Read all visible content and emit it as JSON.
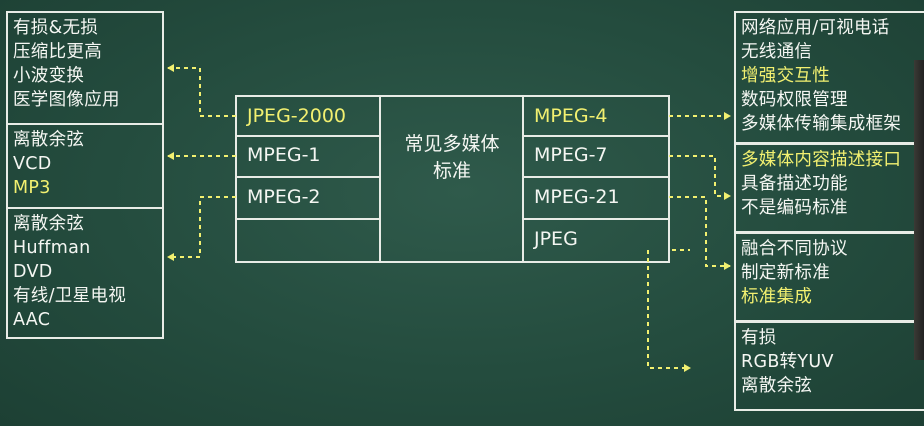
{
  "center": {
    "title_line1": "常见多媒体",
    "title_line2": "标准",
    "left_col": [
      "JPEG-2000",
      "MPEG-1",
      "MPEG-2",
      ""
    ],
    "right_col": [
      "MPEG-4",
      "MPEG-7",
      "MPEG-21",
      "JPEG"
    ]
  },
  "left_boxes": [
    {
      "lines": [
        {
          "text": "有损&无损",
          "hl": false
        },
        {
          "text": "压缩比更高",
          "hl": false
        },
        {
          "text": "小波变换",
          "hl": false
        },
        {
          "text": "医学图像应用",
          "hl": false
        }
      ]
    },
    {
      "lines": [
        {
          "text": "离散余弦",
          "hl": false
        },
        {
          "text": "VCD",
          "hl": false
        },
        {
          "text": "MP3",
          "hl": true
        }
      ]
    },
    {
      "lines": [
        {
          "text": "离散余弦",
          "hl": false
        },
        {
          "text": "Huffman",
          "hl": false
        },
        {
          "text": "DVD",
          "hl": false
        },
        {
          "text": "有线/卫星电视",
          "hl": false
        },
        {
          "text": "AAC",
          "hl": false
        }
      ]
    }
  ],
  "right_boxes": [
    {
      "lines": [
        {
          "text": "网络应用/可视电话",
          "hl": false
        },
        {
          "text": "无线通信",
          "hl": false
        },
        {
          "text": "增强交互性",
          "hl": true
        },
        {
          "text": "数码权限管理",
          "hl": false
        },
        {
          "text": "多媒体传输集成框架",
          "hl": false
        }
      ]
    },
    {
      "lines": [
        {
          "text": "多媒体内容描述接口",
          "hl": true
        },
        {
          "text": "具备描述功能",
          "hl": false
        },
        {
          "text": "不是编码标准",
          "hl": false
        }
      ]
    },
    {
      "lines": [
        {
          "text": "融合不同协议",
          "hl": false
        },
        {
          "text": "制定新标准",
          "hl": false
        },
        {
          "text": "标准集成",
          "hl": true
        }
      ]
    },
    {
      "lines": [
        {
          "text": "有损",
          "hl": false
        },
        {
          "text": "RGB转YUV",
          "hl": false
        },
        {
          "text": "离散余弦",
          "hl": false
        }
      ]
    }
  ],
  "colors": {
    "background": "#244c3e",
    "highlight": "#f2f070",
    "text": "#f4f6f2",
    "border": "#e8ece6"
  }
}
